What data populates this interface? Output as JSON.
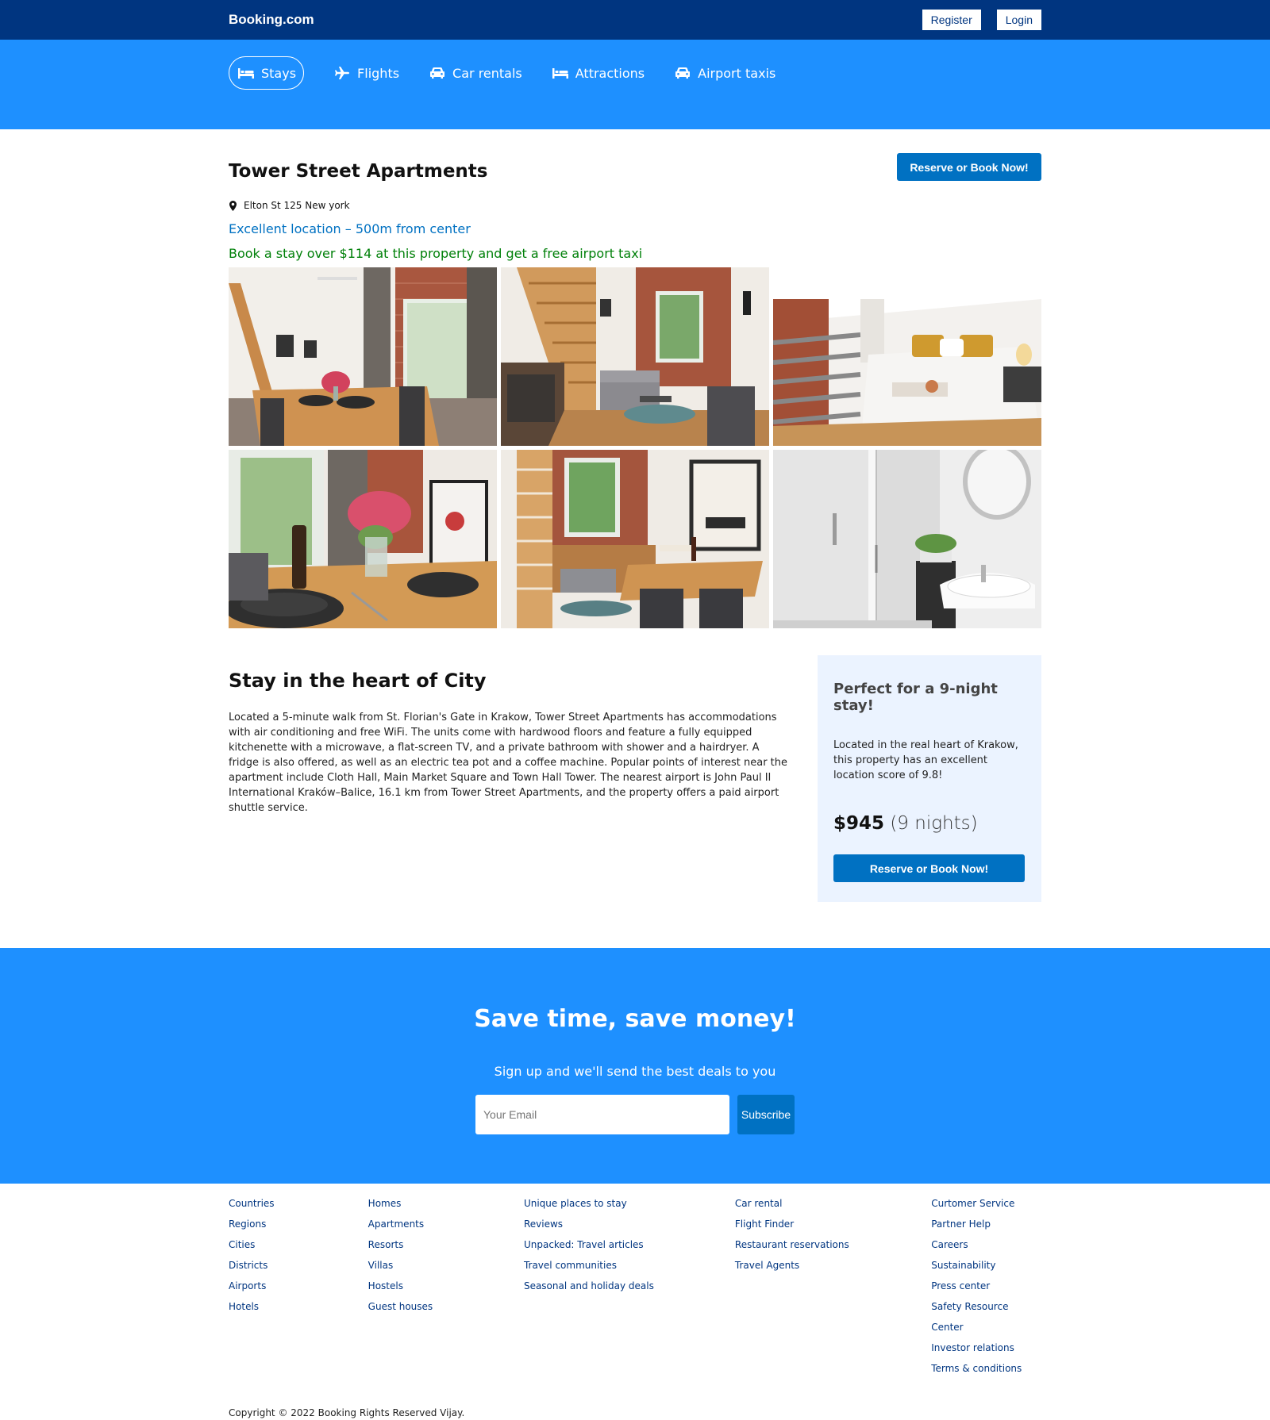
{
  "header": {
    "brand": "Booking.com",
    "register": "Register",
    "login": "Login"
  },
  "nav": [
    {
      "label": "Stays",
      "icon": "bed-icon"
    },
    {
      "label": "Flights",
      "icon": "plane-icon"
    },
    {
      "label": "Car rentals",
      "icon": "car-icon"
    },
    {
      "label": "Attractions",
      "icon": "bed-icon"
    },
    {
      "label": "Airport taxis",
      "icon": "car-icon"
    }
  ],
  "property": {
    "title": "Tower Street Apartments",
    "reserve_label": "Reserve or Book Now!",
    "address": "Elton St 125 New york",
    "location_note": "Excellent location – 500m from center",
    "taxi_offer": "Book a stay over $114 at this property and get a free airport taxi",
    "photos": [
      "dining-room-photo",
      "living-room-stairs-photo",
      "bedroom-photo",
      "table-flowers-photo",
      "living-dining-photo",
      "bathroom-photo"
    ]
  },
  "details": {
    "heading": "Stay in the heart of City",
    "text": "Located a 5-minute walk from St. Florian's Gate in Krakow, Tower Street Apartments has accommodations with air conditioning and free WiFi. The units come with hardwood floors and feature a fully equipped kitchenette with a microwave, a flat-screen TV, and a private bathroom with shower and a hairdryer. A fridge is also offered, as well as an electric tea pot and a coffee machine. Popular points of interest near the apartment include Cloth Hall, Main Market Square and Town Hall Tower. The nearest airport is John Paul II International Kraków–Balice, 16.1 km from Tower Street Apartments, and the property offers a paid airport shuttle service."
  },
  "aside": {
    "heading": "Perfect for a 9-night stay!",
    "text": "Located in the real heart of Krakow, this property has an excellent location score of 9.8!",
    "price": "$945",
    "nights": "(9 nights)",
    "reserve_label": "Reserve or Book Now!"
  },
  "subscribe": {
    "heading": "Save time, save money!",
    "subtext": "Sign up and we'll send the best deals to you",
    "placeholder": "Your Email",
    "button": "Subscribe"
  },
  "footer": {
    "col1": [
      "Countries",
      "Regions",
      "Cities",
      "Districts",
      "Airports",
      "Hotels"
    ],
    "col2": [
      "Homes",
      "Apartments",
      "Resorts",
      "Villas",
      "Hostels",
      "Guest houses"
    ],
    "col3": [
      "Unique places to stay",
      "Reviews",
      "Unpacked: Travel articles",
      "Travel communities",
      "Seasonal and holiday deals"
    ],
    "col4": [
      "Car rental",
      "Flight Finder",
      "Restaurant reservations",
      "Travel Agents"
    ],
    "col5": [
      "Curtomer Service",
      "Partner Help",
      "Careers",
      "Sustainability",
      "Press center",
      "Safety Resource Center",
      "Investor relations",
      "Terms & conditions"
    ],
    "copyright": "Copyright © 2022 Booking Rights Reserved Vijay."
  },
  "colors": {
    "brand_dark": "#003580",
    "brand_blue": "#1e90ff",
    "button": "#0071c2",
    "green": "#008009"
  }
}
